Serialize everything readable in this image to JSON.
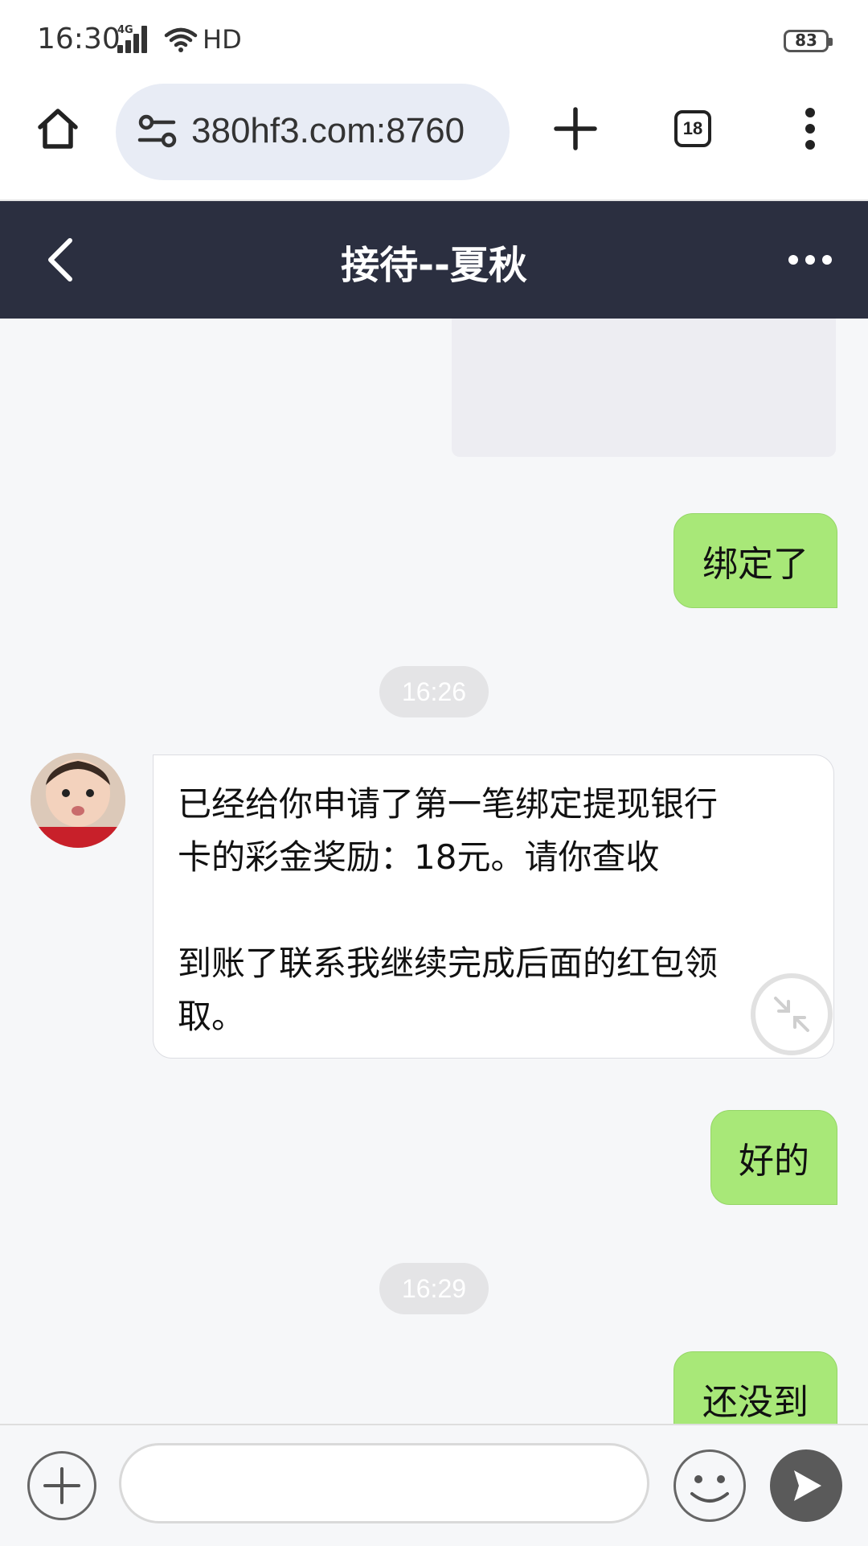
{
  "status_bar": {
    "time": "16:30",
    "network": "4G",
    "hd_label": "HD",
    "battery": "83"
  },
  "browser": {
    "url": "380hf3.com:8760",
    "tab_count": "18",
    "icons": [
      "home-icon",
      "site-settings-icon",
      "new-tab-icon",
      "tab-switcher-icon",
      "more-vert-icon"
    ]
  },
  "chat": {
    "title": "接待--夏秋",
    "icons": [
      "back-icon",
      "more-horiz-icon"
    ]
  },
  "messages": [
    {
      "type": "image",
      "side": "right"
    },
    {
      "type": "text",
      "side": "right",
      "text": "绑定了"
    },
    {
      "type": "time",
      "text": "16:26"
    },
    {
      "type": "text",
      "side": "left",
      "paragraph1_line1": "已经给你申请了第一笔绑定提现银行",
      "paragraph1_line2": "卡的彩金奖励：18元。请你查收",
      "paragraph2_line1": "到账了联系我继续完成后面的红包领",
      "paragraph2_line2": "取。"
    },
    {
      "type": "text",
      "side": "right",
      "text": "好的"
    },
    {
      "type": "time",
      "text": "16:29"
    },
    {
      "type": "text",
      "side": "right",
      "text": "还没到"
    }
  ],
  "input_bar": {
    "placeholder": "",
    "icons": [
      "plus-icon",
      "emoji-icon",
      "send-icon"
    ]
  },
  "colors": {
    "header_bg": "#2b2f40",
    "outgoing_bubble": "#a8e878",
    "page_bg": "#f6f7f9"
  }
}
